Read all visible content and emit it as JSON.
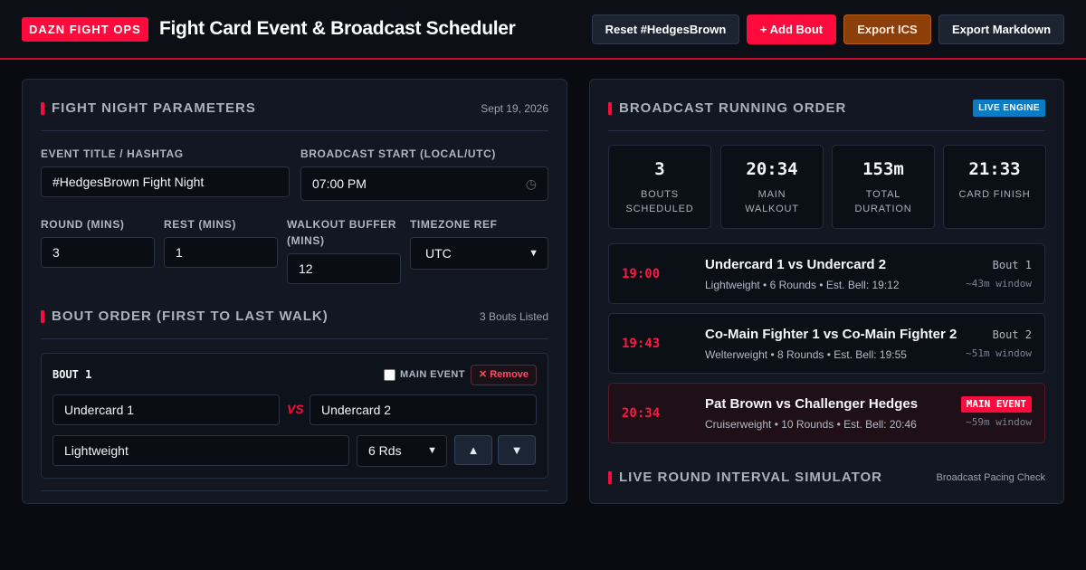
{
  "header": {
    "brand": "DAZN FIGHT OPS",
    "title": "Fight Card Event & Broadcast Scheduler",
    "buttons": {
      "reset": "Reset #HedgesBrown",
      "add": "+ Add Bout",
      "ics": "Export ICS",
      "markdown": "Export Markdown"
    }
  },
  "params": {
    "heading": "FIGHT NIGHT PARAMETERS",
    "date": "Sept 19, 2026",
    "event_title_label": "EVENT TITLE / HASHTAG",
    "event_title_value": "#HedgesBrown Fight Night",
    "broadcast_start_label": "BROADCAST START (LOCAL/UTC)",
    "broadcast_start_value": "07:00 PM",
    "round_label": "ROUND (MINS)",
    "round_value": "3",
    "rest_label": "REST (MINS)",
    "rest_value": "1",
    "walkout_label_1": "WALKOUT BUFFER",
    "walkout_label_2": "(MINS)",
    "walkout_value": "12",
    "timezone_label": "TIMEZONE REF",
    "timezone_value": "UTC"
  },
  "bouts": {
    "heading": "BOUT ORDER (FIRST TO LAST WALK)",
    "count_text": "3 Bouts Listed",
    "card": {
      "label": "BOUT 1",
      "main_event_label": "MAIN EVENT",
      "remove_label": "✕ Remove",
      "fighter_a": "Undercard 1",
      "vs": "VS",
      "fighter_b": "Undercard 2",
      "weight_class": "Lightweight",
      "rounds": "6 Rds",
      "up": "▲",
      "down": "▼"
    }
  },
  "broadcast": {
    "heading": "BROADCAST RUNNING ORDER",
    "badge": "LIVE ENGINE",
    "stats": [
      {
        "value": "3",
        "label_1": "BOUTS",
        "label_2": "SCHEDULED"
      },
      {
        "value": "20:34",
        "label_1": "MAIN",
        "label_2": "WALKOUT"
      },
      {
        "value": "153m",
        "label_1": "TOTAL",
        "label_2": "DURATION"
      },
      {
        "value": "21:33",
        "label_1": "CARD FINISH",
        "label_2": ""
      }
    ],
    "rows": [
      {
        "time": "19:00",
        "title": "Undercard 1 vs Undercard 2",
        "sub": "Lightweight • 6 Rounds • Est. Bell: 19:12",
        "tag": "Bout 1",
        "window": "~43m window"
      },
      {
        "time": "19:43",
        "title": "Co-Main Fighter 1 vs Co-Main Fighter 2",
        "sub": "Welterweight • 8 Rounds • Est. Bell: 19:55",
        "tag": "Bout 2",
        "window": "~51m window"
      },
      {
        "time": "20:34",
        "title": "Pat Brown vs Challenger Hedges",
        "sub": "Cruiserweight • 10 Rounds • Est. Bell: 20:46",
        "tag": "MAIN EVENT",
        "window": "~59m window"
      }
    ],
    "simulator_heading": "LIVE ROUND INTERVAL SIMULATOR",
    "simulator_meta": "Broadcast Pacing Check"
  }
}
